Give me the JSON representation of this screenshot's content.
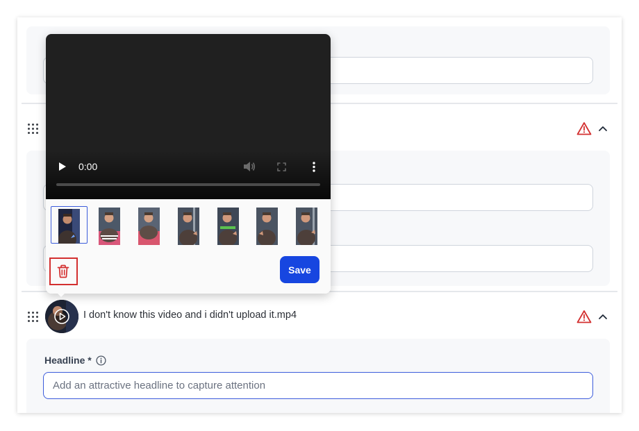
{
  "file_row": {
    "title": "I don't know this video and i didn't upload it.mp4"
  },
  "headline": {
    "label": "Headline *",
    "placeholder": "Add an attractive headline to capture attention"
  },
  "video_player": {
    "time": "0:00",
    "progress_fraction": 0
  },
  "thumbnail_frames": [
    {
      "caption": ""
    },
    {
      "caption": "What do you think he's hiding?"
    },
    {
      "caption": ""
    },
    {
      "caption": ""
    },
    {
      "caption": ""
    },
    {
      "caption": ""
    },
    {
      "caption": ""
    }
  ],
  "actions": {
    "save_label": "Save"
  },
  "colors": {
    "accent": "#1746e0",
    "warning": "#d32f2f",
    "selection": "#3b5bdb"
  },
  "icons": {
    "drag": "drag-handle-icon",
    "warning": "warning-triangle-icon",
    "collapse": "chevron-up-icon",
    "info": "info-icon",
    "delete": "trash-icon",
    "play": "play-icon",
    "volume": "volume-icon",
    "fullscreen": "fullscreen-icon",
    "more": "more-vertical-icon"
  }
}
